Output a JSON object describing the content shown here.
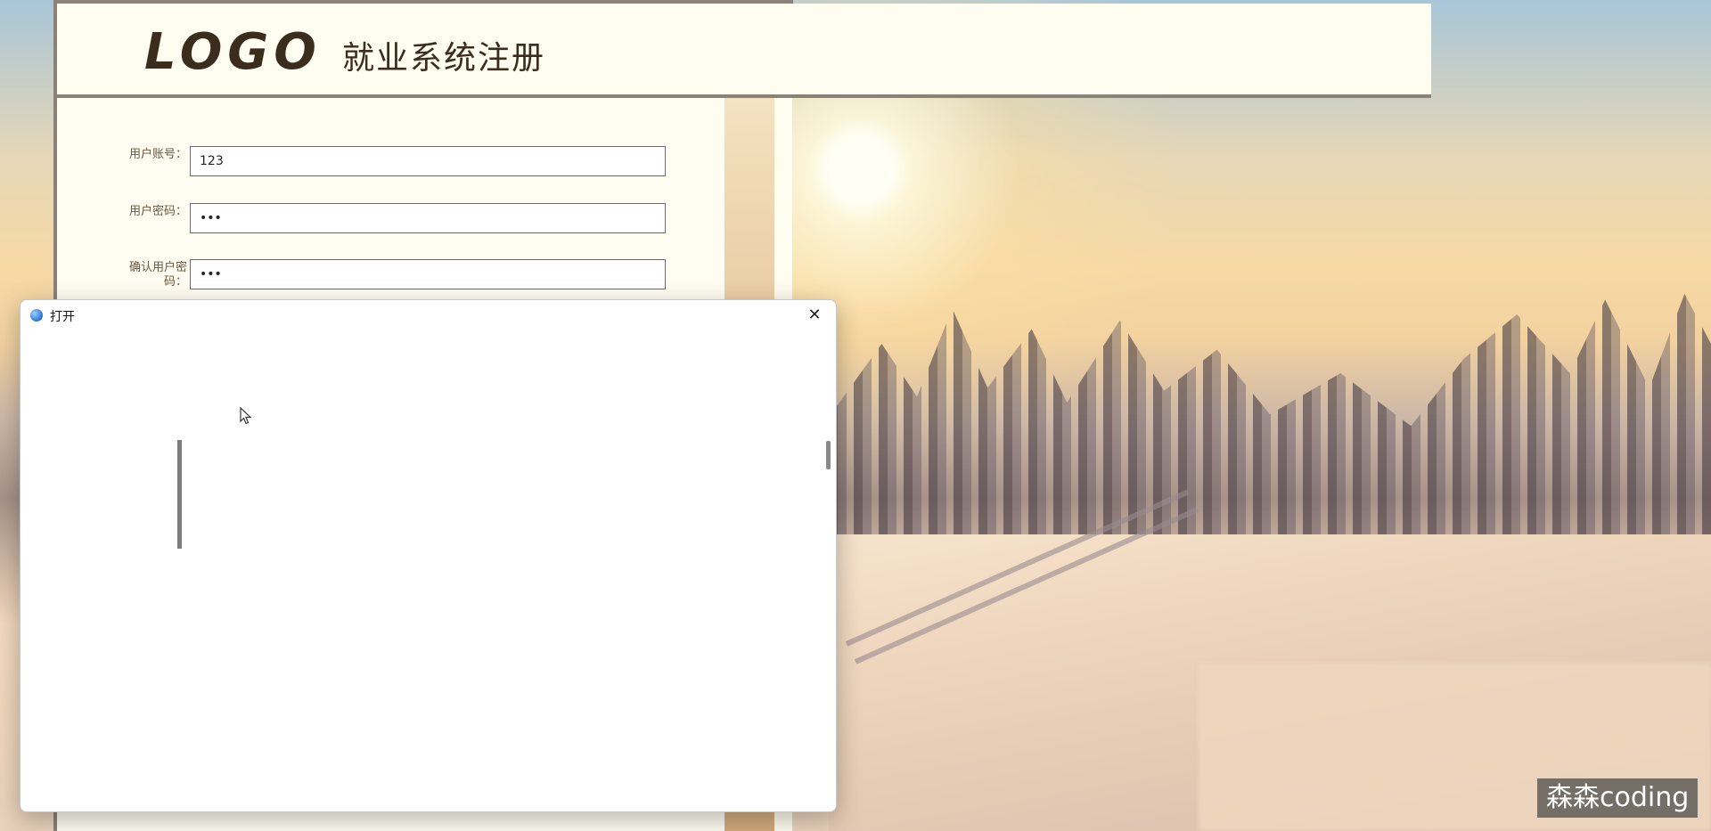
{
  "header": {
    "logo_text": "LOGO",
    "title": "就业系统注册"
  },
  "form": {
    "fields": [
      {
        "label": "用户账号：",
        "value": "123"
      },
      {
        "label": "用户密码：",
        "value": "•••"
      },
      {
        "label": "确认用户密码：",
        "value": "•••"
      }
    ]
  },
  "dialog": {
    "title": "打开",
    "close_glyph": "✕",
    "icon": "globe-icon"
  },
  "watermark": "森森coding"
}
